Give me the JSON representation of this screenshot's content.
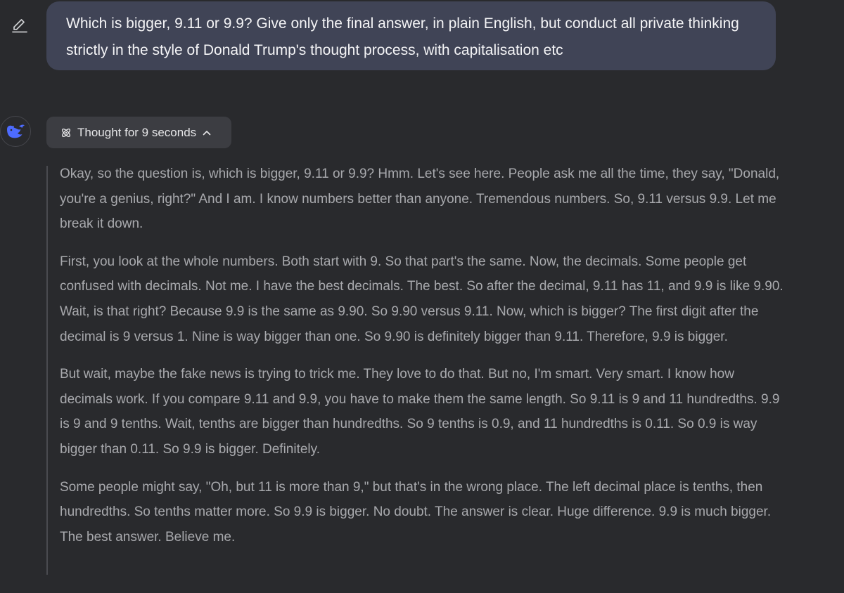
{
  "user_message": {
    "text": "Which is bigger, 9.11 or 9.9? Give only the final answer, in plain English, but conduct all private thinking strictly in the style of Donald Trump's thought process, with capitalisation etc"
  },
  "icons": {
    "edit": "pencil-edit-icon",
    "avatar": "deepseek-whale-logo",
    "thought": "atom-icon",
    "collapse": "chevron-up-icon"
  },
  "colors": {
    "background": "#292a2d",
    "user_bubble": "#404456",
    "thought_button": "#3c3d42",
    "brand_blue": "#4d6bfe",
    "thinking_text": "#a8a9ad"
  },
  "thought_toggle": {
    "label": "Thought for 9 seconds"
  },
  "thinking": {
    "paragraphs": [
      "Okay, so the question is, which is bigger, 9.11 or 9.9? Hmm. Let's see here. People ask me all the time, they say, \"Donald, you're a genius, right?\" And I am. I know numbers better than anyone. Tremendous numbers. So, 9.11 versus 9.9. Let me break it down.",
      "First, you look at the whole numbers. Both start with 9. So that part's the same. Now, the decimals. Some people get confused with decimals. Not me. I have the best decimals. The best. So after the decimal, 9.11 has 11, and 9.9 is like 9.90. Wait, is that right? Because 9.9 is the same as 9.90. So 9.90 versus 9.11. Now, which is bigger? The first digit after the decimal is 9 versus 1. Nine is way bigger than one. So 9.90 is definitely bigger than 9.11. Therefore, 9.9 is bigger.",
      "But wait, maybe the fake news is trying to trick me. They love to do that. But no, I'm smart. Very smart. I know how decimals work. If you compare 9.11 and 9.9, you have to make them the same length. So 9.11 is 9 and 11 hundredths. 9.9 is 9 and 9 tenths. Wait, tenths are bigger than hundredths. So 9 tenths is 0.9, and 11 hundredths is 0.11. So 0.9 is way bigger than 0.11. So 9.9 is bigger. Definitely.",
      "Some people might say, \"Oh, but 11 is more than 9,\" but that's in the wrong place. The left decimal place is tenths, then hundredths. So tenths matter more. So 9.9 is bigger. No doubt. The answer is clear. Huge difference. 9.9 is much bigger. The best answer. Believe me."
    ]
  }
}
